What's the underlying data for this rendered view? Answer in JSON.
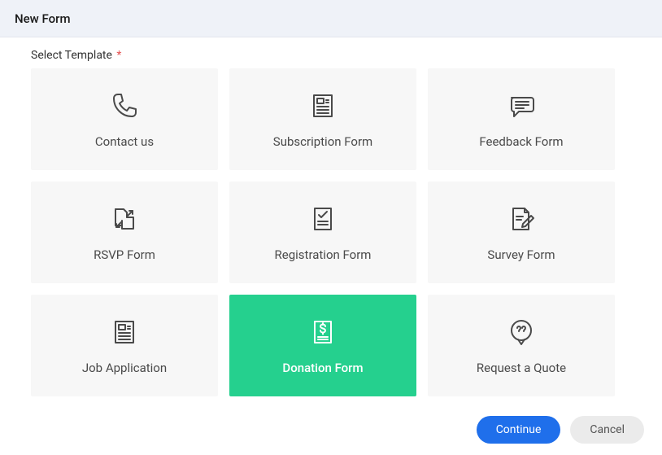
{
  "header": {
    "title": "New Form"
  },
  "section": {
    "label": "Select Template",
    "required": "*"
  },
  "templates": [
    {
      "id": "contact-us",
      "label": "Contact us",
      "icon": "phone-icon",
      "selected": false
    },
    {
      "id": "subscription-form",
      "label": "Subscription Form",
      "icon": "newspaper-icon",
      "selected": false
    },
    {
      "id": "feedback-form",
      "label": "Feedback Form",
      "icon": "speech-bubble-icon",
      "selected": false
    },
    {
      "id": "rsvp-form",
      "label": "RSVP Form",
      "icon": "file-transfer-icon",
      "selected": false
    },
    {
      "id": "registration-form",
      "label": "Registration Form",
      "icon": "file-check-icon",
      "selected": false
    },
    {
      "id": "survey-form",
      "label": "Survey Form",
      "icon": "file-pencil-icon",
      "selected": false
    },
    {
      "id": "job-application",
      "label": "Job Application",
      "icon": "newspaper-icon",
      "selected": false
    },
    {
      "id": "donation-form",
      "label": "Donation Form",
      "icon": "file-dollar-icon",
      "selected": true
    },
    {
      "id": "request-a-quote",
      "label": "Request a Quote",
      "icon": "quote-bubble-icon",
      "selected": false
    }
  ],
  "footer": {
    "continue": "Continue",
    "cancel": "Cancel"
  }
}
